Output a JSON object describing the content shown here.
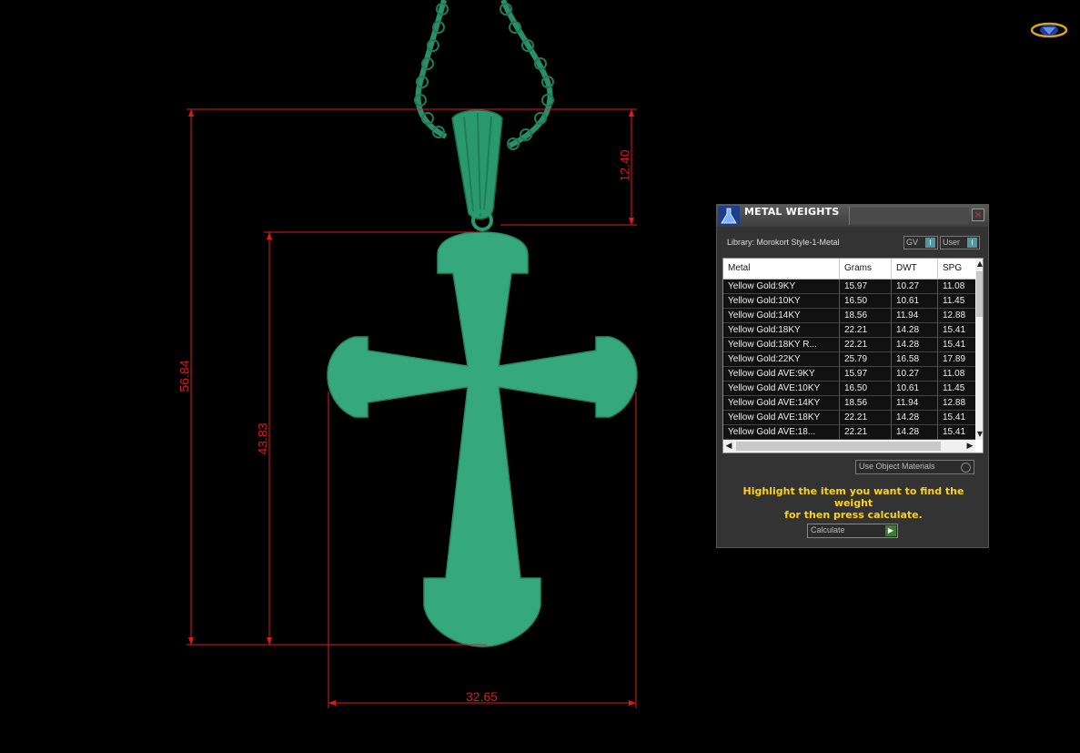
{
  "dimensions": {
    "overall_height": "56.84",
    "cross_height": "43.83",
    "bail_height": "12.40",
    "width": "32.65"
  },
  "colors": {
    "dimension_line": "#e01a1a",
    "model_green": "#35a97d",
    "hint_text": "#ffd21a"
  },
  "panel": {
    "title": "METAL WEIGHTS",
    "close_icon": "×",
    "library_label": "Library: Morokort Style-1-Metal",
    "toggle_gv": "GV",
    "toggle_user": "User",
    "table": {
      "headers": [
        "Metal",
        "Grams",
        "DWT",
        "SPG"
      ],
      "rows": [
        [
          "Yellow Gold:9KY",
          "15.97",
          "10.27",
          "11.08"
        ],
        [
          "Yellow Gold:10KY",
          "16.50",
          "10.61",
          "11.45"
        ],
        [
          "Yellow Gold:14KY",
          "18.56",
          "11.94",
          "12.88"
        ],
        [
          "Yellow Gold:18KY",
          "22.21",
          "14.28",
          "15.41"
        ],
        [
          "Yellow Gold:18KY R...",
          "22.21",
          "14.28",
          "15.41"
        ],
        [
          "Yellow Gold:22KY",
          "25.79",
          "16.58",
          "17.89"
        ],
        [
          "Yellow Gold AVE:9KY",
          "15.97",
          "10.27",
          "11.08"
        ],
        [
          "Yellow Gold AVE:10KY",
          "16.50",
          "10.61",
          "11.45"
        ],
        [
          "Yellow Gold AVE:14KY",
          "18.56",
          "11.94",
          "12.88"
        ],
        [
          "Yellow Gold AVE:18KY",
          "22.21",
          "14.28",
          "15.41"
        ],
        [
          "Yellow Gold AVE:18...",
          "22.21",
          "14.28",
          "15.41"
        ]
      ]
    },
    "use_object_materials": "Use Object Materials",
    "hint_line1": "Highlight the item you want to find the weight",
    "hint_line2": "for then press calculate.",
    "calculate_label": "Calculate"
  }
}
